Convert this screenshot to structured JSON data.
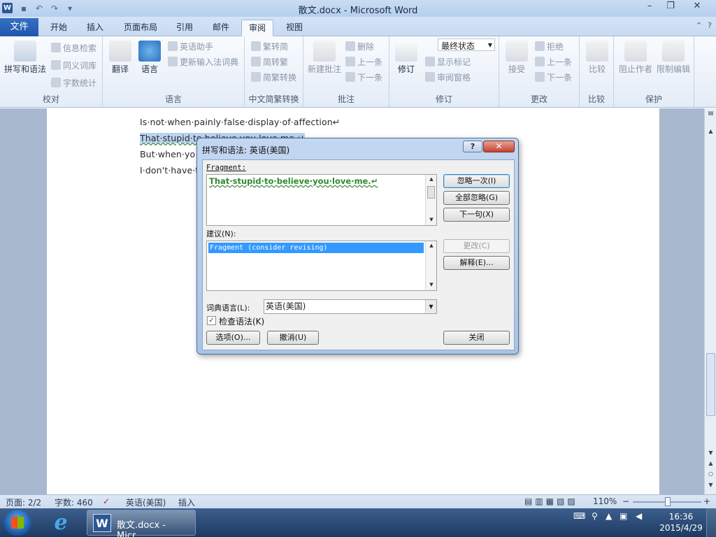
{
  "app": {
    "title": "散文.docx - Microsoft Word",
    "logo_letter": "W",
    "window": {
      "minimize": "–",
      "restore": "❐",
      "close": "✕"
    }
  },
  "menu": {
    "file": "文件",
    "tabs": [
      "开始",
      "插入",
      "页面布局",
      "引用",
      "邮件",
      "审阅",
      "视图"
    ],
    "active_tab": "审阅"
  },
  "ribbon": {
    "proofing": {
      "label": "校对",
      "spelling": "拼写和语法",
      "research": "信息检索",
      "thesaurus": "同义词库",
      "wordcount": "字数统计"
    },
    "language": {
      "label": "语言",
      "translate": "翻译",
      "language": "语言",
      "english_helper": "英语助手",
      "update_ime": "更新输入法词典"
    },
    "chinese": {
      "label": "中文简繁转换",
      "trad_to_simp": "繁转简",
      "simp_to_trad": "简转繁",
      "convert": "简繁转换"
    },
    "comments": {
      "label": "批注",
      "new": "新建批注",
      "delete": "删除",
      "previous": "上一条",
      "next": "下一条"
    },
    "tracking": {
      "label": "修订",
      "track": "修订",
      "final_state": "最终状态",
      "show_markup": "显示标记",
      "review_pane": "审阅窗格"
    },
    "changes": {
      "label": "更改",
      "accept": "接受",
      "reject": "拒绝",
      "previous": "上一条",
      "next": "下一条"
    },
    "compare": {
      "label": "比较",
      "compare": "比较"
    },
    "protect": {
      "label": "保护",
      "block_authors": "阻止作者",
      "restrict": "限制编辑"
    }
  },
  "document": {
    "lines": [
      "Is·not·when·painly·false·display·of·affection↵",
      "That·stupid·to·believe·you·love·me.↵",
      "But·when·yo",
      "I·don't·have·t"
    ]
  },
  "dialog": {
    "title": "拼写和语法: 英语(美国)",
    "help": "?",
    "close": "✕",
    "fragment_label": "Fragment:",
    "fragment_text": "That·stupid·to·believe·you·love·me.↵",
    "suggestions_label": "建议(N):",
    "suggestion": "Fragment (consider revising)",
    "dictionary_label": "词典语言(L):",
    "dictionary_value": "英语(美国)",
    "check_grammar": "检查语法(K)",
    "check_mark": "✓",
    "buttons": {
      "ignore_once": "忽略一次(I)",
      "ignore_all": "全部忽略(G)",
      "next_sentence": "下一句(X)",
      "change": "更改(C)",
      "explain": "解释(E)...",
      "options": "选项(O)...",
      "undo": "撤消(U)",
      "close": "关闭"
    }
  },
  "status": {
    "page": "页面: 2/2",
    "words": "字数: 460",
    "language": "英语(美国)",
    "mode": "插入",
    "zoom": "110%",
    "zoom_out": "−",
    "zoom_in": "+"
  },
  "taskbar": {
    "item": "散文.docx - Micr...",
    "time": "16:36",
    "date": "2015/4/29"
  }
}
